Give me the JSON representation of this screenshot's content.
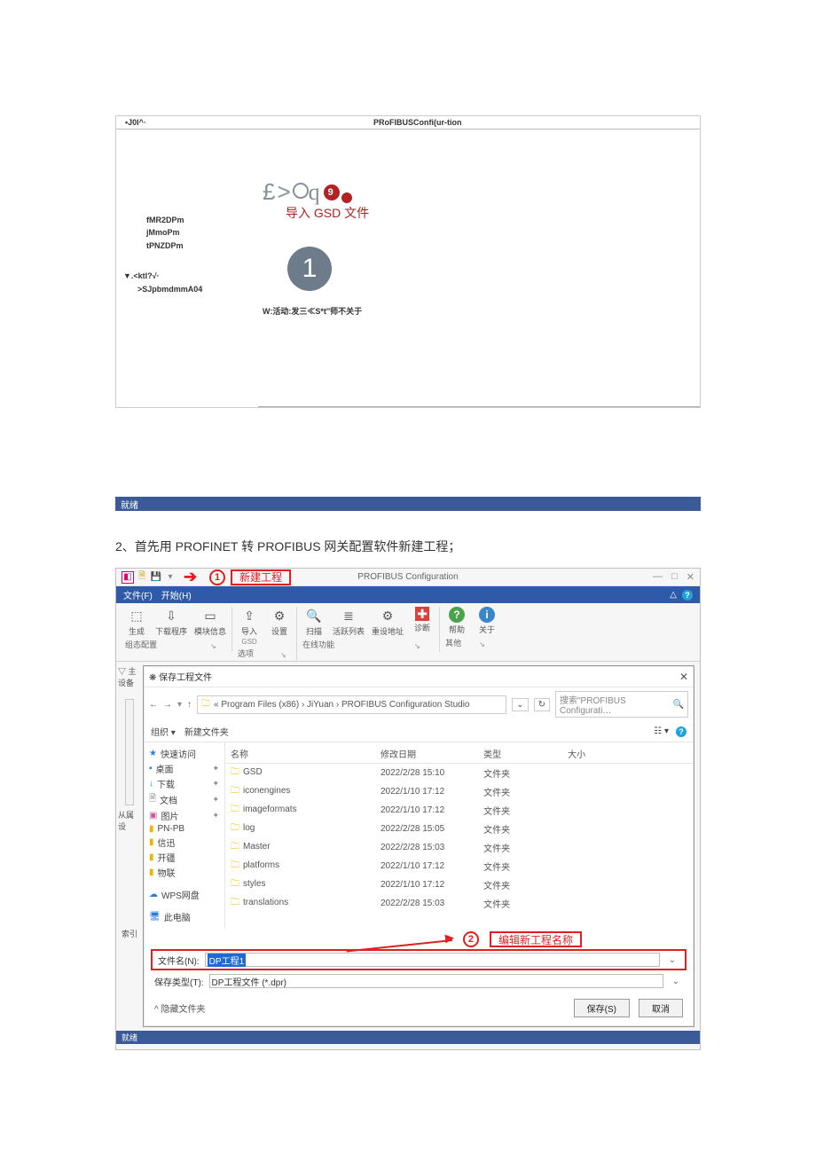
{
  "fig1": {
    "title_left": "•J0I^·",
    "title_center": "PRoFIBUSConfi(ur-tion",
    "tree": {
      "items": [
        "fMR2DPm",
        "jMmoPm",
        "tPNZDPm"
      ],
      "expander": "▼.<ktl?√·",
      "sub": ">SJpbmdmmA04"
    },
    "glyphs_prefix": "£> ",
    "q": "q",
    "badge": "9",
    "gsd_caption": "导入 GSD 文件",
    "big_num": "1",
    "hint": "W:活动:发三≪S*t″师不关于"
  },
  "status1": "就绪",
  "step_caption": "2、首先用 PROFINET 转 PROFIBUS 网关配置软件新建工程；",
  "fig2": {
    "callout1_num": "1",
    "callout1_text": "新建工程",
    "callout2_num": "2",
    "callout2_text": "编辑新工程名称",
    "app_title": "PROFIBUS Configuration",
    "win_btns": [
      "—",
      "□",
      "✕"
    ],
    "menubar": {
      "file": "文件(F)",
      "start": "开始(H)",
      "help_dot": "?",
      "gear": "△"
    },
    "ribbon": {
      "g1": {
        "items": [
          {
            "icon": "⬚",
            "label": "生成"
          },
          {
            "icon": "⇩",
            "label": "下载程序"
          },
          {
            "icon": "▭",
            "label": "模块信息"
          }
        ],
        "group": "组态配置"
      },
      "g2": {
        "items": [
          {
            "icon": "⇪",
            "label": "导入",
            "sub": "GSD"
          },
          {
            "icon": "⚙",
            "label": "设置"
          }
        ],
        "group": "选项"
      },
      "g3": {
        "items": [
          {
            "icon": "🔍",
            "label": "扫描"
          },
          {
            "icon": "≣",
            "label": "活跃列表"
          },
          {
            "icon": "⚙",
            "label": "重设地址"
          },
          {
            "icon": "✚",
            "label": "诊断",
            "cls": "red"
          }
        ],
        "group": "在线功能"
      },
      "g4": {
        "items": [
          {
            "icon": "?",
            "label": "帮助",
            "round": "1"
          },
          {
            "icon": "i",
            "label": "关于",
            "round": "1"
          }
        ],
        "group": "其他"
      }
    },
    "left_panel": {
      "a": "▽ 主设备",
      "b": "从属设",
      "c": "索引"
    },
    "dialog": {
      "title": "❋ 保存工程文件",
      "nav_back": "←",
      "nav_fwd": "→",
      "nav_up": "↑",
      "crumb": "« Program Files (x86) › JiYuan › PROFIBUS Configuration Studio",
      "refresh": "↻",
      "search_placeholder": "搜索\"PROFIBUS Configurati…",
      "search_icon": "🔍",
      "toolbar": {
        "org": "组织 ▾",
        "newf": "新建文件夹",
        "view": "☷ ▾"
      },
      "sidenav": [
        {
          "icon": "★",
          "label": "快速访问",
          "color": "#2a7de1"
        },
        {
          "icon": "▪",
          "label": "桌面",
          "color": "#2a7de1",
          "pin": true
        },
        {
          "icon": "↓",
          "label": "下载",
          "color": "#2aa36b",
          "pin": true
        },
        {
          "icon": "🗎",
          "label": "文档",
          "color": "#888",
          "pin": true
        },
        {
          "icon": "▣",
          "label": "图片",
          "color": "#c05d9e",
          "pin": true
        },
        {
          "icon": "▮",
          "label": "PN-PB",
          "color": "#f0b400"
        },
        {
          "icon": "▮",
          "label": "信迅",
          "color": "#f0b400"
        },
        {
          "icon": "▮",
          "label": "开疆",
          "color": "#f0b400"
        },
        {
          "icon": "▮",
          "label": "物联",
          "color": "#f0b400"
        },
        {
          "icon": "☁",
          "label": "WPS网盘",
          "color": "#2a7de1",
          "sep_before": true
        },
        {
          "icon": "🖥",
          "label": "此电脑",
          "color": "#2a7de1",
          "sep_before": true
        }
      ],
      "columns": [
        "名称",
        "修改日期",
        "类型",
        "大小"
      ],
      "rows": [
        {
          "name": "GSD",
          "date": "2022/2/28 15:10",
          "type": "文件夹"
        },
        {
          "name": "iconengines",
          "date": "2022/1/10 17:12",
          "type": "文件夹"
        },
        {
          "name": "imageformats",
          "date": "2022/1/10 17:12",
          "type": "文件夹"
        },
        {
          "name": "log",
          "date": "2022/2/28 15:05",
          "type": "文件夹"
        },
        {
          "name": "Master",
          "date": "2022/2/28 15:03",
          "type": "文件夹"
        },
        {
          "name": "platforms",
          "date": "2022/1/10 17:12",
          "type": "文件夹"
        },
        {
          "name": "styles",
          "date": "2022/1/10 17:12",
          "type": "文件夹"
        },
        {
          "name": "translations",
          "date": "2022/2/28 15:03",
          "type": "文件夹"
        }
      ],
      "filename_label": "文件名(N):",
      "filename_value": "DP工程1",
      "filetype_label": "保存类型(T):",
      "filetype_value": "DP工程文件 (*.dpr)",
      "hide_folders": "^ 隐藏文件夹",
      "save_btn": "保存(S)",
      "cancel_btn": "取消"
    },
    "statusbar": "就绪"
  }
}
